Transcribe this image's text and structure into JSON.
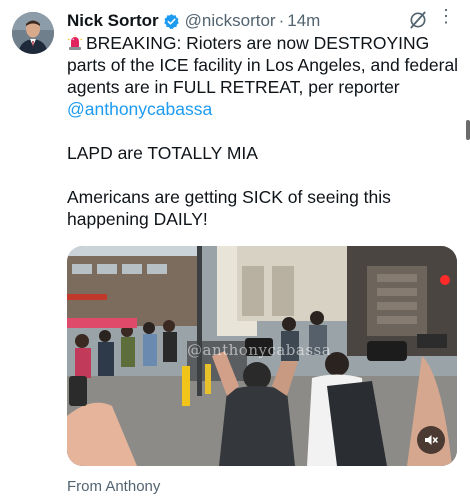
{
  "tweet": {
    "author_name": "Nick Sortor",
    "handle": "@nicksortor",
    "separator": "·",
    "time": "14m",
    "text_part1": "BREAKING: Rioters are now DESTROYING parts of the ICE facility in Los Angeles, and federal agents are in FULL RETREAT, per reporter ",
    "mention": "@anthonycabassa",
    "text_part2": "\n\nLAPD are TOTALLY MIA\n\nAmericans are getting SICK of seeing this happening DAILY!",
    "more_glyph": "⋮",
    "media_watermark": "@anthonycabassa",
    "from_label": "From Anthony"
  },
  "icons": {
    "verified": "verified-badge-icon",
    "alarm": "police-light-icon",
    "grok": "grok-icon",
    "mute": "speaker-muted-icon"
  },
  "colors": {
    "accent": "#1d9bf0",
    "secondary_text": "#536471",
    "primary_text": "#0f1419"
  }
}
